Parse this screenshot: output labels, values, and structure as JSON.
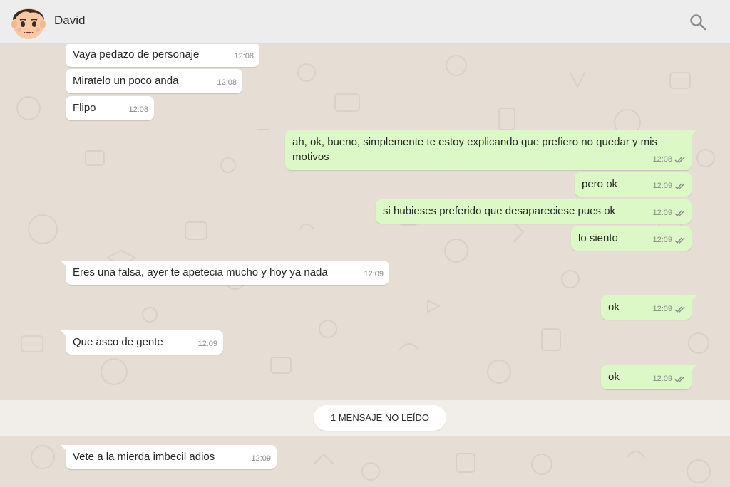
{
  "header": {
    "contact_name": "David",
    "avatar_icon": "boy-emoji-avatar",
    "search_icon": "search-icon"
  },
  "colors": {
    "header_bg": "#ededed",
    "chat_bg": "#e6ded5",
    "incoming_bubble": "#ffffff",
    "outgoing_bubble": "#dcf8c6",
    "read_ticks": "#8a8a8a"
  },
  "messages": [
    {
      "direction": "in",
      "text": "Vaya pedazo de personaje",
      "time": "12:08"
    },
    {
      "direction": "in",
      "text": "Miratelo un poco anda",
      "time": "12:08"
    },
    {
      "direction": "in",
      "text": "Flipo",
      "time": "12:08"
    },
    {
      "direction": "out",
      "text": "ah, ok, bueno, simplemente te estoy explicando que prefiero no quedar y mis motivos",
      "time": "12:08",
      "status": "read-double-check"
    },
    {
      "direction": "out",
      "text": "pero ok",
      "time": "12:09",
      "status": "read-double-check"
    },
    {
      "direction": "out",
      "text": "si hubieses preferido que desapareciese pues ok",
      "time": "12:09",
      "status": "read-double-check"
    },
    {
      "direction": "out",
      "text": "lo siento",
      "time": "12:09",
      "status": "read-double-check"
    },
    {
      "direction": "in",
      "text": "Eres una falsa, ayer te apetecia mucho y hoy ya nada",
      "time": "12:09"
    },
    {
      "direction": "out",
      "text": "ok",
      "time": "12:09",
      "status": "read-double-check"
    },
    {
      "direction": "in",
      "text": "Que asco de gente",
      "time": "12:09"
    },
    {
      "direction": "out",
      "text": "ok",
      "time": "12:09",
      "status": "read-double-check"
    },
    {
      "direction": "in",
      "text": "Vete a la mierda imbecil adios",
      "time": "12:09"
    }
  ],
  "unread_divider": {
    "label": "1 MENSAJE NO LEÍDO"
  }
}
